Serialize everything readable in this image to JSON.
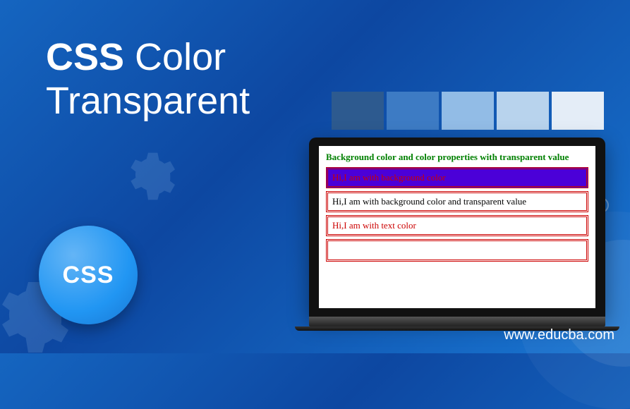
{
  "title": {
    "bold": "CSS",
    "rest_line1": " Color",
    "line2": "Transparent"
  },
  "badge": {
    "label": "CSS"
  },
  "swatches": {
    "colors": [
      "#2d5a8f",
      "#3d7bc4",
      "#92bce6",
      "#b8d3ed",
      "#e4edf7"
    ]
  },
  "demo": {
    "heading": "Background color and color properties with transparent value",
    "rows": [
      "Hi,I am with background color",
      "Hi,I am with background color and transparent value",
      "Hi,I am with text color",
      ""
    ]
  },
  "footer": {
    "url": "www.educba.com"
  }
}
